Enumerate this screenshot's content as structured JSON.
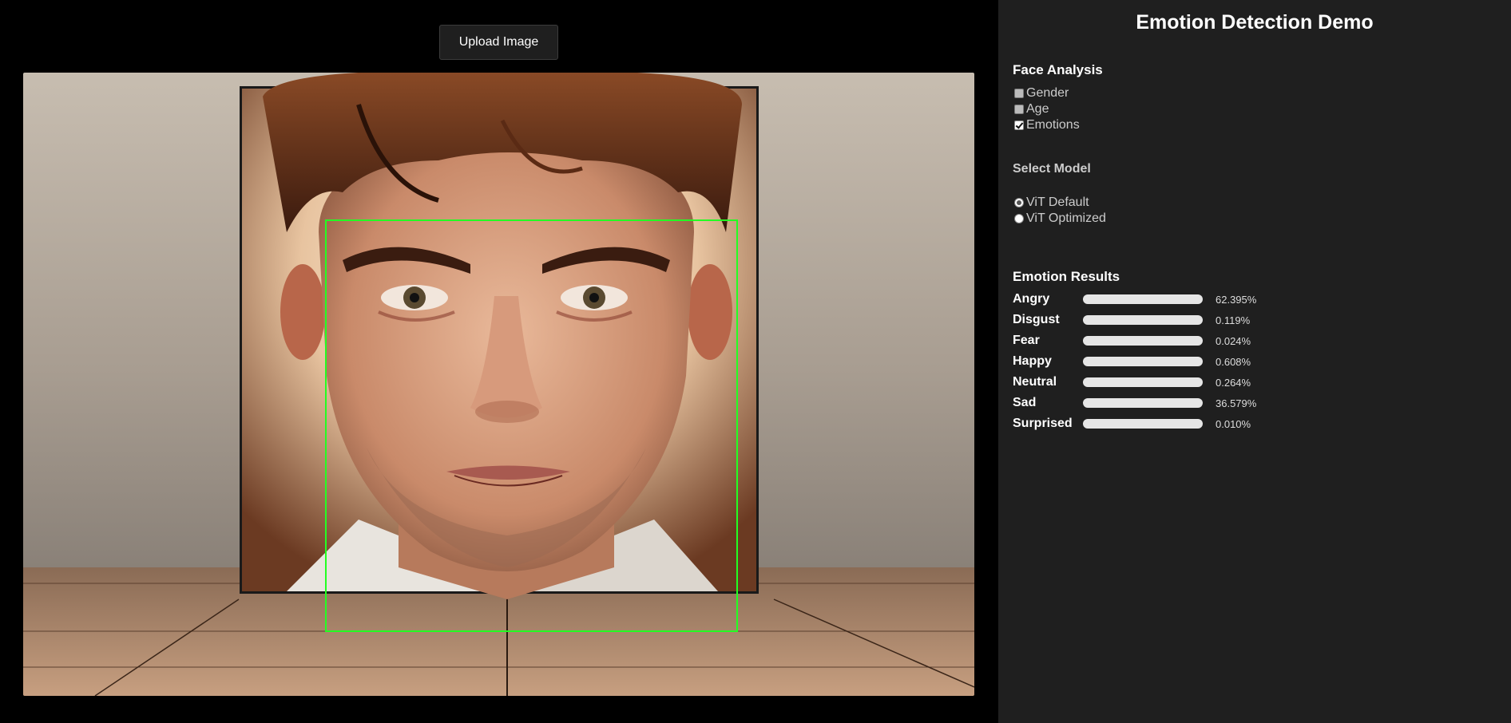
{
  "upload": {
    "label": "Upload Image"
  },
  "sidebar": {
    "title": "Emotion Detection Demo",
    "face_analysis": {
      "title": "Face Analysis",
      "options": [
        {
          "label": "Gender",
          "checked": false
        },
        {
          "label": "Age",
          "checked": false
        },
        {
          "label": "Emotions",
          "checked": true
        }
      ]
    },
    "model": {
      "title": "Select Model",
      "options": [
        {
          "label": "ViT Default",
          "selected": true
        },
        {
          "label": "ViT Optimized",
          "selected": false
        }
      ]
    },
    "results": {
      "title": "Emotion Results",
      "items": [
        {
          "label": "Angry",
          "percent": "62.395%",
          "value": 62.395,
          "color": "#d9534f"
        },
        {
          "label": "Disgust",
          "percent": "0.119%",
          "value": 0.119,
          "color": "#5cb85c"
        },
        {
          "label": "Fear",
          "percent": "0.024%",
          "value": 0.024,
          "color": "#8e5ea2"
        },
        {
          "label": "Happy",
          "percent": "0.608%",
          "value": 0.608,
          "color": "#f0ad4e"
        },
        {
          "label": "Neutral",
          "percent": "0.264%",
          "value": 0.264,
          "color": "#999999"
        },
        {
          "label": "Sad",
          "percent": "36.579%",
          "value": 36.579,
          "color": "#4db8e0"
        },
        {
          "label": "Surprised",
          "percent": "0.010%",
          "value": 0.01,
          "color": "#e377c2"
        }
      ]
    }
  },
  "colors": {
    "face_box": "#22ff22",
    "sidebar_bg": "#1f1f1f"
  }
}
